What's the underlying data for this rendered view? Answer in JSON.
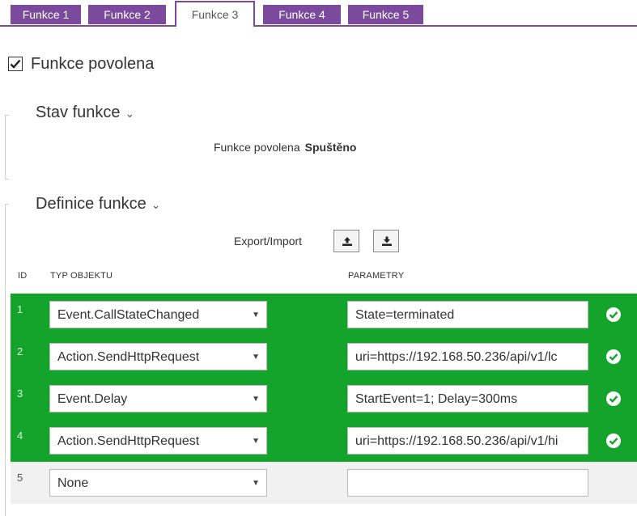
{
  "tabs": [
    {
      "label": "Funkce 1",
      "active": false
    },
    {
      "label": "Funkce 2",
      "active": false
    },
    {
      "label": "Funkce 3",
      "active": true
    },
    {
      "label": "Funkce 4",
      "active": false
    },
    {
      "label": "Funkce 5",
      "active": false
    }
  ],
  "enabled": {
    "label": "Funkce povolena",
    "checked": true
  },
  "status_section": {
    "title": "Stav funkce",
    "status_label": "Funkce povolena",
    "status_value": "Spuštěno"
  },
  "definition_section": {
    "title": "Definice funkce",
    "export_import_label": "Export/Import",
    "export_icon": "upload-icon",
    "import_icon": "download-icon"
  },
  "table": {
    "headers": {
      "id": "ID",
      "type": "TYP OBJEKTU",
      "params": "PARAMETRY"
    },
    "rows": [
      {
        "id": "1",
        "type": "Event.CallStateChanged",
        "params": "State=terminated",
        "valid": true
      },
      {
        "id": "2",
        "type": "Action.SendHttpRequest",
        "params": "uri=https://192.168.50.236/api/v1/lc",
        "valid": true
      },
      {
        "id": "3",
        "type": "Event.Delay",
        "params": "StartEvent=1; Delay=300ms",
        "valid": true
      },
      {
        "id": "4",
        "type": "Action.SendHttpRequest",
        "params": "uri=https://192.168.50.236/api/v1/hi",
        "valid": true
      },
      {
        "id": "5",
        "type": "None",
        "params": "",
        "valid": false
      }
    ]
  },
  "colors": {
    "accent": "#7b4a9c",
    "valid_row": "#14a32b",
    "empty_row": "#f1f1f1"
  }
}
